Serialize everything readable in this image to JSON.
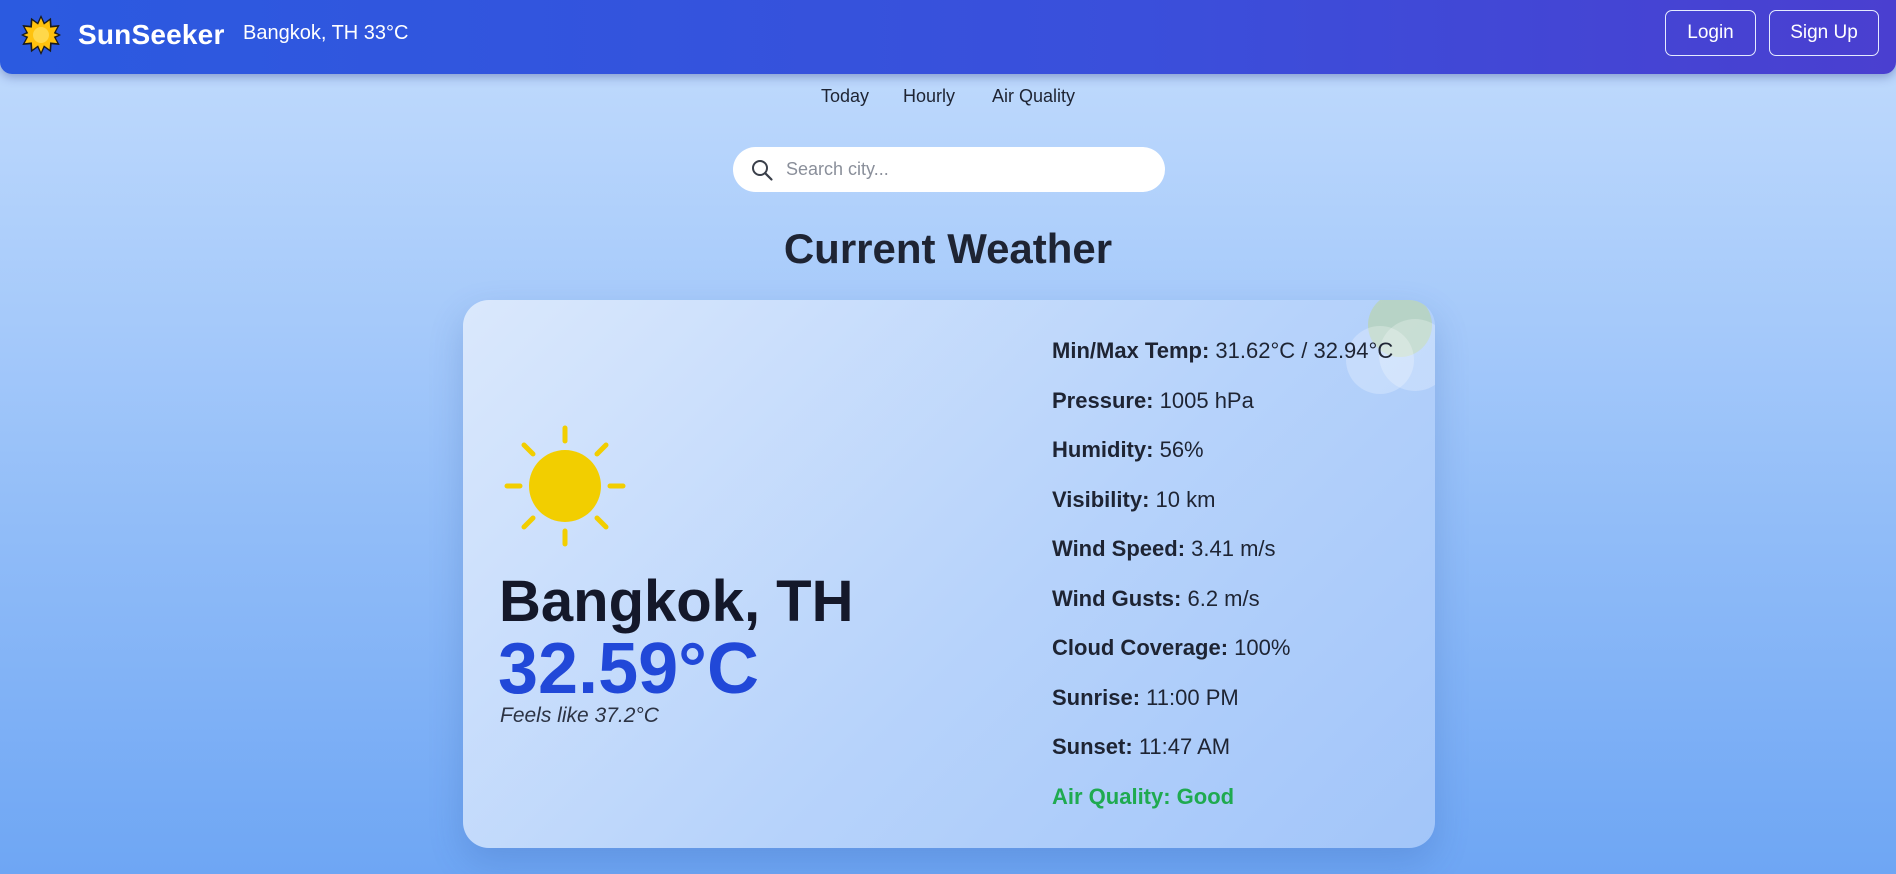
{
  "header": {
    "brand_name": "SunSeeker",
    "location_temp": "Bangkok, TH 33°C",
    "login_label": "Login",
    "signup_label": "Sign Up",
    "brand_color": "#2b5ae0"
  },
  "nav": {
    "items": [
      {
        "label": "Today"
      },
      {
        "label": "Hourly"
      },
      {
        "label": "Air Quality"
      }
    ]
  },
  "search": {
    "placeholder": "Search city...",
    "value": ""
  },
  "page_title": "Current Weather",
  "weather": {
    "icon": "sun-icon",
    "city": "Bangkok, TH",
    "temperature": "32.59°C",
    "feels_like": "Feels like 37.2°C",
    "accent_color": "#2148d8",
    "details": [
      {
        "label": "Min/Max Temp:",
        "value": "31.62°C / 32.94°C"
      },
      {
        "label": "Pressure:",
        "value": "1005 hPa"
      },
      {
        "label": "Humidity:",
        "value": "56%"
      },
      {
        "label": "Visibility:",
        "value": "10 km"
      },
      {
        "label": "Wind Speed:",
        "value": "3.41 m/s"
      },
      {
        "label": "Wind Gusts:",
        "value": "6.2 m/s"
      },
      {
        "label": "Cloud Coverage:",
        "value": "100%"
      },
      {
        "label": "Sunrise:",
        "value": "11:00 PM"
      },
      {
        "label": "Sunset:",
        "value": "11:47 AM"
      }
    ],
    "air_quality": "Air Quality: Good",
    "air_quality_color": "#1faa50"
  }
}
